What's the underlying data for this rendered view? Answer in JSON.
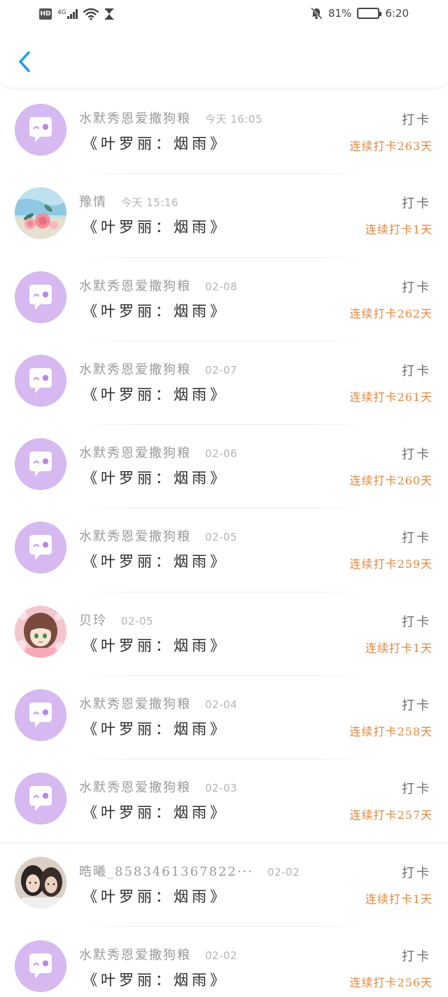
{
  "status_bar": {
    "hd": "HD",
    "network": "4G",
    "battery_percent": "81%",
    "battery_level": 0.81,
    "time": "6:20",
    "icons": [
      "signal-icon",
      "wifi-icon",
      "hourglass-icon",
      "bell-off-icon",
      "battery-icon"
    ]
  },
  "nav": {
    "back_icon": "chevron-left-icon",
    "accent": "#2a9de8"
  },
  "colors": {
    "avatar_default": "#d5b9f0",
    "streak": "#e3873e"
  },
  "items": [
    {
      "name": "水默秀恩爱撒狗粮",
      "time": "今天 16:05",
      "content": "《叶罗丽：烟雨》",
      "tag": "打卡",
      "streak": "连续打卡263天",
      "avatar": "default"
    },
    {
      "name": "豫情",
      "time": "今天 15:16",
      "content": "《叶罗丽：烟雨》",
      "tag": "打卡",
      "streak": "连续打卡1天",
      "avatar": "flowers"
    },
    {
      "name": "水默秀恩爱撒狗粮",
      "time": "02-08",
      "content": "《叶罗丽：烟雨》",
      "tag": "打卡",
      "streak": "连续打卡262天",
      "avatar": "default"
    },
    {
      "name": "水默秀恩爱撒狗粮",
      "time": "02-07",
      "content": "《叶罗丽：烟雨》",
      "tag": "打卡",
      "streak": "连续打卡261天",
      "avatar": "default"
    },
    {
      "name": "水默秀恩爱撒狗粮",
      "time": "02-06",
      "content": "《叶罗丽：烟雨》",
      "tag": "打卡",
      "streak": "连续打卡260天",
      "avatar": "default"
    },
    {
      "name": "水默秀恩爱撒狗粮",
      "time": "02-05",
      "content": "《叶罗丽：烟雨》",
      "tag": "打卡",
      "streak": "连续打卡259天",
      "avatar": "default"
    },
    {
      "name": "贝玲",
      "time": "02-05",
      "content": "《叶罗丽：烟雨》",
      "tag": "打卡",
      "streak": "连续打卡1天",
      "avatar": "anime"
    },
    {
      "name": "水默秀恩爱撒狗粮",
      "time": "02-04",
      "content": "《叶罗丽：烟雨》",
      "tag": "打卡",
      "streak": "连续打卡258天",
      "avatar": "default"
    },
    {
      "name": "水默秀恩爱撒狗粮",
      "time": "02-03",
      "content": "《叶罗丽：烟雨》",
      "tag": "打卡",
      "streak": "连续打卡257天",
      "avatar": "default"
    },
    {
      "name": "晧曦_8583461367822···",
      "time": "02-02",
      "content": "《叶罗丽：烟雨》",
      "tag": "打卡",
      "streak": "连续打卡1天",
      "avatar": "photo"
    },
    {
      "name": "水默秀恩爱撒狗粮",
      "time": "02-02",
      "content": "《叶罗丽：烟雨》",
      "tag": "打卡",
      "streak": "连续打卡256天",
      "avatar": "default"
    }
  ]
}
